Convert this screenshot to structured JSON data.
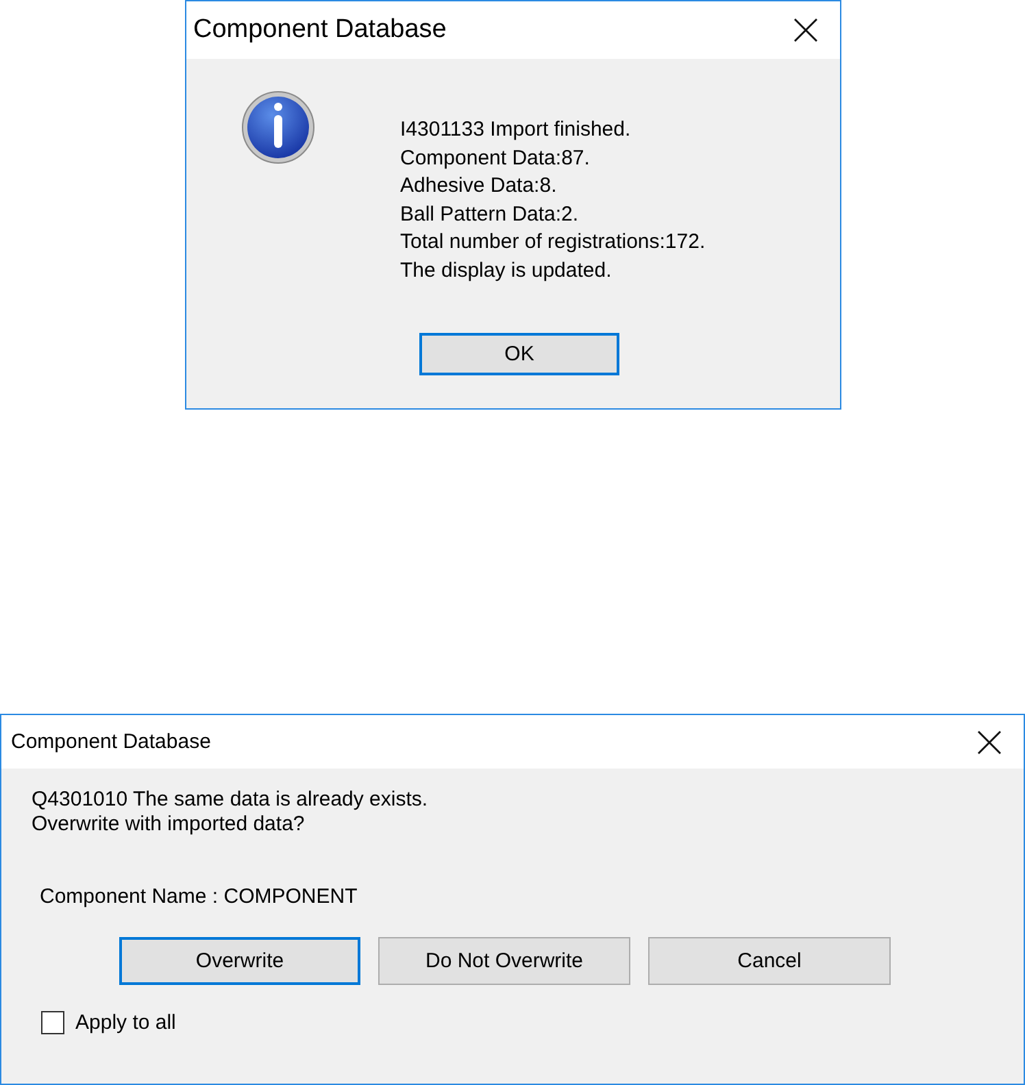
{
  "dialogs": [
    {
      "title": "Component Database",
      "message_lines": [
        "I4301133 Import finished.",
        "Component Data:87.",
        "Adhesive Data:8.",
        "Ball Pattern Data:2.",
        "Total number of registrations:172.",
        "The display is updated."
      ],
      "buttons": [
        {
          "label": "OK",
          "focused": true
        }
      ]
    },
    {
      "title": "Component Database",
      "message_lines": [
        "Q4301010 The same data is already exists.",
        "Overwrite with imported data?"
      ],
      "detail": "Component Name : COMPONENT",
      "buttons": [
        {
          "label": "Overwrite",
          "focused": true
        },
        {
          "label": "Do Not Overwrite",
          "focused": false
        },
        {
          "label": "Cancel",
          "focused": false
        }
      ],
      "checkbox": {
        "label": "Apply to all",
        "checked": false
      }
    }
  ]
}
